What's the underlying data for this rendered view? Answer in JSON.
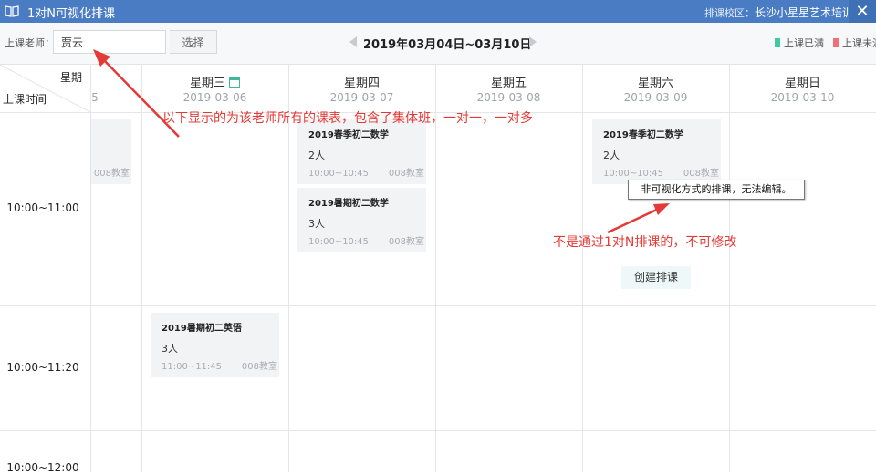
{
  "titlebar": {
    "title": "1对N可视化排课",
    "campus_label": "排课校区：",
    "campus_value": "长沙小星星艺术培训学校",
    "close_glyph": "✕"
  },
  "toolbar": {
    "teacher_label": "上课老师：",
    "teacher_value": "贾云",
    "select_label": "选择",
    "week_range": "2019年03月04日~03月10日",
    "legend": [
      {
        "label": "上课已满",
        "color": "#3fc7a6"
      },
      {
        "label": "上课未满",
        "color": "#f0707a"
      }
    ]
  },
  "grid": {
    "corner_week": "星期",
    "corner_time": "上课时间",
    "days": [
      {
        "name": "",
        "date": "5"
      },
      {
        "name": "星期三",
        "date": "2019-03-06",
        "today": true
      },
      {
        "name": "星期四",
        "date": "2019-03-07"
      },
      {
        "name": "星期五",
        "date": "2019-03-08"
      },
      {
        "name": "星期六",
        "date": "2019-03-09"
      },
      {
        "name": "星期日",
        "date": "2019-03-10"
      }
    ],
    "time_slots": [
      "10:00~11:00",
      "10:00~11:20",
      "10:00~12:00"
    ]
  },
  "courses": {
    "tue_partial": {
      "title": "",
      "count": "",
      "time": "",
      "room": "008教室"
    },
    "thu_1": {
      "title": "2019春季初二数学",
      "count": "2人",
      "time": "10:00~10:45",
      "room": "008教室"
    },
    "thu_2": {
      "title": "2019暑期初二数学",
      "count": "3人",
      "time": "10:00~10:45",
      "room": "008教室"
    },
    "sat_1": {
      "title": "2019春季初二数学",
      "count": "2人",
      "time": "10:00~10:45",
      "room": "008教室"
    },
    "wed_1": {
      "title": "2019暑期初二英语",
      "count": "3人",
      "time": "11:00~11:45",
      "room": "008教室"
    }
  },
  "tooltip": "非可视化方式的排课，无法编辑。",
  "create_button": "创建排课",
  "annotations": {
    "top": "以下显示的为该老师所有的课表，包含了集体班，一对一，一对多",
    "right": "不是通过1对N排课的，不可修改"
  },
  "colors": {
    "header_blue": "#4a7cc3",
    "annotation_red": "#e53935",
    "card_bg": "#f2f3f5"
  }
}
